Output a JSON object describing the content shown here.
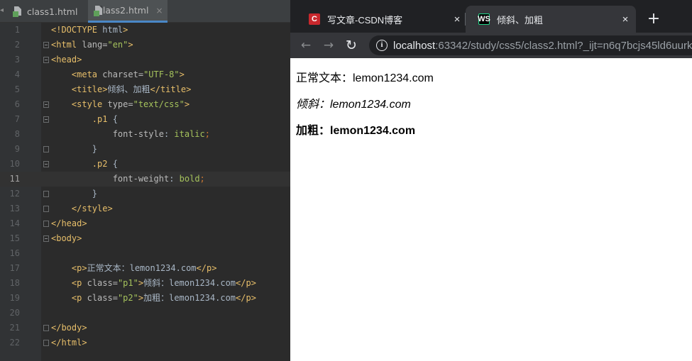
{
  "ide": {
    "tabs": [
      {
        "label": "class1.html",
        "close": "×"
      },
      {
        "label": "class2.html",
        "close": "×"
      }
    ],
    "lines": [
      {
        "num": "1",
        "code": [
          [
            "doctype",
            "<!DOCTYPE"
          ],
          [
            "plain",
            " html"
          ],
          [
            "doctype",
            ">"
          ]
        ]
      },
      {
        "num": "2",
        "code": [
          [
            "tag",
            "<html "
          ],
          [
            "attr",
            "lang="
          ],
          [
            "str",
            "\"en\""
          ],
          [
            "tag",
            ">"
          ]
        ]
      },
      {
        "num": "3",
        "code": [
          [
            "tag",
            "<head>"
          ]
        ]
      },
      {
        "num": "4",
        "code": [
          [
            "plain",
            "    "
          ],
          [
            "tag",
            "<meta "
          ],
          [
            "attr",
            "charset="
          ],
          [
            "str",
            "\"UTF-8\""
          ],
          [
            "tag",
            ">"
          ]
        ]
      },
      {
        "num": "5",
        "code": [
          [
            "plain",
            "    "
          ],
          [
            "tag",
            "<title>"
          ],
          [
            "plain",
            "倾斜、加粗"
          ],
          [
            "tag",
            "</title>"
          ]
        ]
      },
      {
        "num": "6",
        "code": [
          [
            "plain",
            "    "
          ],
          [
            "tag",
            "<style "
          ],
          [
            "attr",
            "type="
          ],
          [
            "str",
            "\"text/css\""
          ],
          [
            "tag",
            ">"
          ]
        ]
      },
      {
        "num": "7",
        "code": [
          [
            "plain",
            "        "
          ],
          [
            "sel",
            ".p1"
          ],
          [
            "plain",
            " {"
          ]
        ]
      },
      {
        "num": "8",
        "code": [
          [
            "plain",
            "            "
          ],
          [
            "prop",
            "font-style"
          ],
          [
            "plain",
            ": "
          ],
          [
            "val",
            "italic"
          ],
          [
            "punct",
            ";"
          ]
        ]
      },
      {
        "num": "9",
        "code": [
          [
            "plain",
            "        }"
          ]
        ]
      },
      {
        "num": "10",
        "code": [
          [
            "plain",
            "        "
          ],
          [
            "sel",
            ".p2"
          ],
          [
            "plain",
            " {"
          ]
        ]
      },
      {
        "num": "11",
        "code": [
          [
            "plain",
            "            "
          ],
          [
            "prop",
            "font-weight"
          ],
          [
            "plain",
            ": "
          ],
          [
            "val",
            "bold"
          ],
          [
            "punct",
            ";"
          ]
        ]
      },
      {
        "num": "12",
        "code": [
          [
            "plain",
            "        }"
          ]
        ]
      },
      {
        "num": "13",
        "code": [
          [
            "plain",
            "    "
          ],
          [
            "tag",
            "</style>"
          ]
        ]
      },
      {
        "num": "14",
        "code": [
          [
            "tag",
            "</head>"
          ]
        ]
      },
      {
        "num": "15",
        "code": [
          [
            "tag",
            "<body>"
          ]
        ]
      },
      {
        "num": "16",
        "code": []
      },
      {
        "num": "17",
        "code": [
          [
            "plain",
            "    "
          ],
          [
            "tag",
            "<p>"
          ],
          [
            "plain",
            "正常文本：lemon1234.com"
          ],
          [
            "tag",
            "</p>"
          ]
        ]
      },
      {
        "num": "18",
        "code": [
          [
            "plain",
            "    "
          ],
          [
            "tag",
            "<p "
          ],
          [
            "attr",
            "class="
          ],
          [
            "str",
            "\"p1\""
          ],
          [
            "tag",
            ">"
          ],
          [
            "plain",
            "倾斜：lemon1234.com"
          ],
          [
            "tag",
            "</p>"
          ]
        ]
      },
      {
        "num": "19",
        "code": [
          [
            "plain",
            "    "
          ],
          [
            "tag",
            "<p "
          ],
          [
            "attr",
            "class="
          ],
          [
            "str",
            "\"p2\""
          ],
          [
            "tag",
            ">"
          ],
          [
            "plain",
            "加粗：lemon1234.com"
          ],
          [
            "tag",
            "</p>"
          ]
        ]
      },
      {
        "num": "20",
        "code": []
      },
      {
        "num": "21",
        "code": [
          [
            "tag",
            "</body>"
          ]
        ]
      },
      {
        "num": "22",
        "code": [
          [
            "tag",
            "</html>"
          ]
        ]
      }
    ],
    "current_line": "11"
  },
  "browser": {
    "tabs": [
      {
        "title": "写文章-CSDN博客",
        "favicon": "C",
        "close": "×"
      },
      {
        "title": "倾斜、加粗",
        "favicon": "WS",
        "close": "×"
      }
    ],
    "new_tab": "+",
    "nav": {
      "back": "←",
      "forward": "→",
      "reload": "↻"
    },
    "info_icon": "i",
    "url_host": "localhost",
    "url_rest": ":63342/study/css5/class2.html?_ijt=n6q7bcjs45ld6uurk",
    "page": {
      "normal": "正常文本：lemon1234.com",
      "italic": "倾斜：lemon1234.com",
      "bold": "加粗：lemon1234.com"
    }
  }
}
